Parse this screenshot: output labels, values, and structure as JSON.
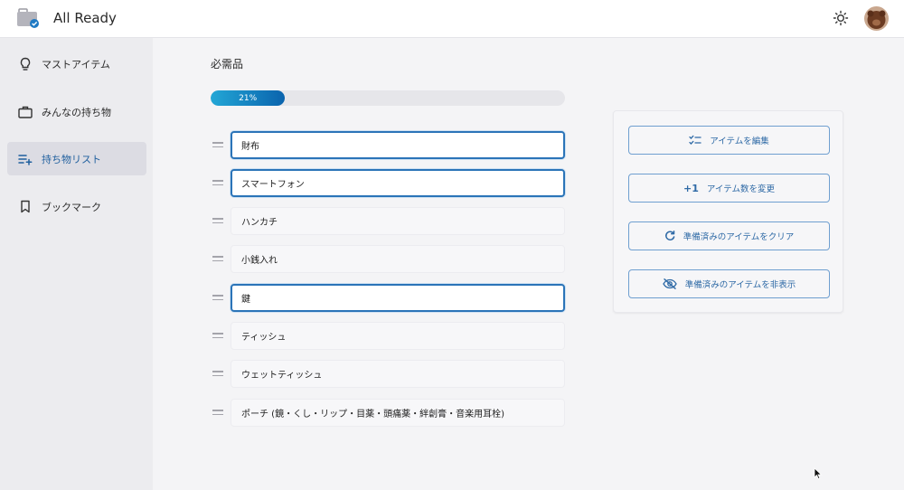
{
  "app": {
    "title": "All Ready"
  },
  "sidebar": {
    "items": [
      {
        "label": "マストアイテム",
        "icon": "lightbulb-icon",
        "active": false
      },
      {
        "label": "みんなの持ち物",
        "icon": "briefcase-icon",
        "active": false
      },
      {
        "label": "持ち物リスト",
        "icon": "playlist-add-icon",
        "active": true
      },
      {
        "label": "ブックマーク",
        "icon": "bookmark-icon",
        "active": false
      }
    ]
  },
  "main": {
    "title": "必需品",
    "progress": {
      "label": "21%",
      "value": 0.21
    },
    "items": [
      {
        "label": "財布",
        "checked": true
      },
      {
        "label": "スマートフォン",
        "checked": true
      },
      {
        "label": "ハンカチ",
        "checked": false
      },
      {
        "label": "小銭入れ",
        "checked": false
      },
      {
        "label": "鍵",
        "checked": true
      },
      {
        "label": "ティッシュ",
        "checked": false
      },
      {
        "label": "ウェットティッシュ",
        "checked": false
      },
      {
        "label": "ポーチ (鏡・くし・リップ・目薬・頭痛薬・絆創膏・音楽用耳栓)",
        "checked": false
      }
    ]
  },
  "actions": {
    "edit_items": "アイテムを編集",
    "change_count_prefix": "+1",
    "change_count": "アイテム数を変更",
    "clear_ready": "準備済みのアイテムをクリア",
    "hide_ready": "準備済みのアイテムを非表示"
  },
  "colors": {
    "accent": "#2b74b8",
    "progress_start": "#23a7d6",
    "progress_end": "#0a63ad",
    "active_nav": "#1f5f9e"
  }
}
